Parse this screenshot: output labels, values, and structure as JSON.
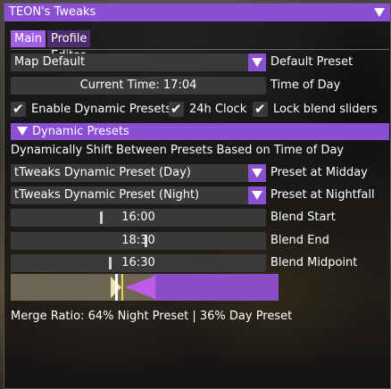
{
  "window": {
    "title": "TEON's Tweaks"
  },
  "tabs": [
    {
      "label": "Main",
      "active": true
    },
    {
      "label": "Profile Editor",
      "active": false
    }
  ],
  "preset": {
    "value": "Map Default",
    "label": "Default Preset"
  },
  "time": {
    "value": "Current Time: 17:04",
    "label": "Time of Day"
  },
  "checks": [
    {
      "label": "Enable Dynamic Presets",
      "checked": true
    },
    {
      "label": "24h Clock",
      "checked": true
    },
    {
      "label": "Lock blend sliders",
      "checked": true
    }
  ],
  "dynamic": {
    "header": "Dynamic Presets",
    "description": "Dynamically Shift Between Presets Based on Time of Day",
    "midday": {
      "value": "tTweaks Dynamic Preset (Day)",
      "label": "Preset at Midday"
    },
    "nightfall": {
      "value": "tTweaks Dynamic Preset (Night)",
      "label": "Preset at Nightfall"
    },
    "blend_start": {
      "value": "16:00",
      "label": "Blend Start"
    },
    "blend_end": {
      "value": "18:30",
      "label": "Blend End"
    },
    "blend_mid": {
      "value": "16:30",
      "label": "Blend Midpoint"
    },
    "merge_ratio": "Merge Ratio: 64% Night Preset | 36% Day Preset",
    "night_fraction": 0.64,
    "day_fraction": 0.36
  },
  "colors": {
    "accent": "#8b4fd4",
    "accent_light": "#a35ee6",
    "night_bar": "#8a4ec8",
    "day_bar": "#6e6552",
    "marker": "#e8d34a"
  }
}
